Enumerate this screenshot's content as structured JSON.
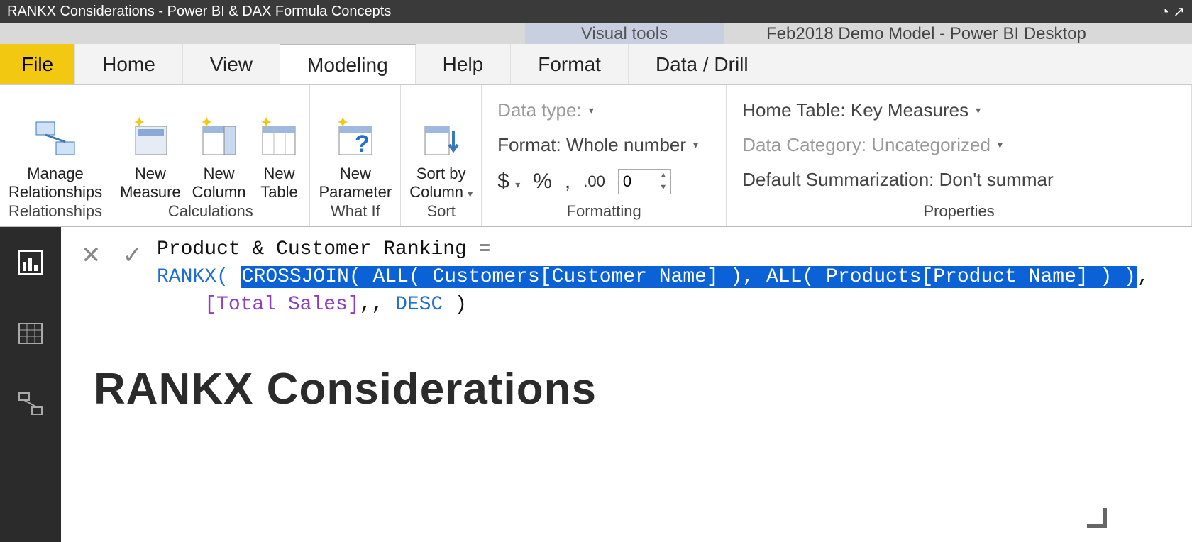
{
  "topbar": {
    "video_title": "RANKX Considerations - Power BI & DAX Formula Concepts"
  },
  "context": {
    "tab": "Visual tools",
    "app_title": "Feb2018 Demo Model - Power BI Desktop"
  },
  "tabs": {
    "file": "File",
    "home": "Home",
    "view": "View",
    "modeling": "Modeling",
    "help": "Help",
    "format": "Format",
    "datadrill": "Data / Drill"
  },
  "ribbon": {
    "relationships": {
      "manage": "Manage\nRelationships",
      "group": "Relationships"
    },
    "calculations": {
      "measure": "New\nMeasure",
      "column": "New\nColumn",
      "table": "New\nTable",
      "group": "Calculations"
    },
    "whatif": {
      "param": "New\nParameter",
      "group": "What If"
    },
    "sort": {
      "sortby": "Sort by\nColumn",
      "group": "Sort"
    },
    "formatting": {
      "datatype": "Data type:",
      "format": "Format: Whole number",
      "decimals": "0",
      "group": "Formatting"
    },
    "properties": {
      "home_table": "Home Table: Key Measures",
      "data_category": "Data Category: Uncategorized",
      "default_summ": "Default Summarization: Don't summar",
      "group": "Properties"
    }
  },
  "formula": {
    "line1_pre": "Product & Customer Ranking = ",
    "line2_rankx": "RANKX( ",
    "line2_hl": "CROSSJOIN( ALL( Customers[Customer Name] ), ALL( Products[Product Name] ) )",
    "line3_indent": "    [Total Sales],, ",
    "line3_desc": "DESC",
    "line3_tail": " )"
  },
  "canvas": {
    "heading": "RANKX Considerations"
  }
}
